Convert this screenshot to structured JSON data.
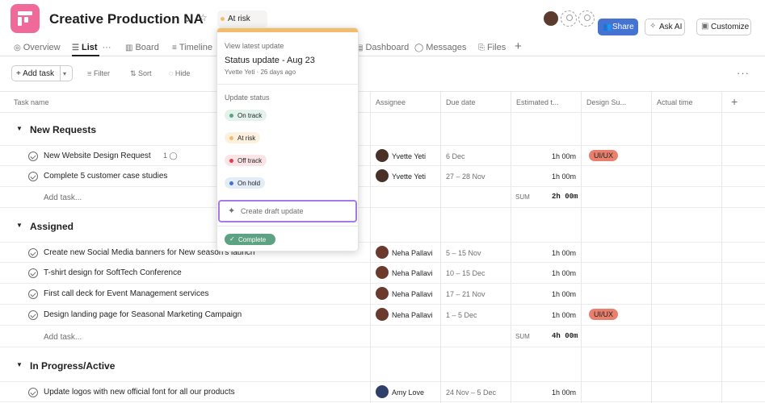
{
  "project": {
    "title": "Creative Production NA",
    "status": "At risk",
    "colors": {
      "brand": "#f06a99",
      "at_risk": "#f1bd6c",
      "share": "#4573d2",
      "badge": "#e8806d"
    }
  },
  "header_buttons": {
    "share": "Share",
    "ask_ai": "Ask AI",
    "customize": "Customize"
  },
  "tabs": [
    {
      "label": "Overview",
      "icon": "overview-icon"
    },
    {
      "label": "List",
      "icon": "list-icon",
      "active": true
    },
    {
      "label": "Board",
      "icon": "board-icon"
    },
    {
      "label": "Timeline",
      "icon": "timeline-icon"
    },
    {
      "label": "Dashboard",
      "icon": "dashboard-icon"
    },
    {
      "label": "Messages",
      "icon": "messages-icon"
    },
    {
      "label": "Files",
      "icon": "files-icon"
    }
  ],
  "toolbar": {
    "add_task": "+ Add task",
    "filter": "Filter",
    "sort": "Sort",
    "hide": "Hide"
  },
  "columns": [
    "Task name",
    "Assignee",
    "Due date",
    "Estimated t...",
    "Design Su...",
    "Actual time"
  ],
  "sections": [
    {
      "name": "New Requests",
      "tasks": [
        {
          "name": "New Website Design Request",
          "subtasks": "1",
          "assignee": "Yvette Yeti",
          "due": "6 Dec",
          "est": "1h 00m",
          "design": "UI/UX"
        },
        {
          "name": "Complete 5 customer case studies",
          "assignee": "Yvette Yeti",
          "due": "27 – 28 Nov",
          "est": "1h 00m"
        }
      ],
      "add_task": "Add task...",
      "sum_label": "SUM",
      "sum_value": "2h 00m"
    },
    {
      "name": "Assigned",
      "tasks": [
        {
          "name": "Create new Social Media banners for New season's launch",
          "assignee": "Neha Pallavi",
          "due": "5 – 15 Nov",
          "est": "1h 00m"
        },
        {
          "name": "T-shirt design for SoftTech Conference",
          "assignee": "Neha Pallavi",
          "due": "10 – 15 Dec",
          "est": "1h 00m"
        },
        {
          "name": "First call deck for Event Management services",
          "assignee": "Neha Pallavi",
          "due": "17 – 21 Nov",
          "est": "1h 00m"
        },
        {
          "name": "Design landing page for Seasonal Marketing Campaign",
          "assignee": "Neha Pallavi",
          "due": "1 – 5 Dec",
          "est": "1h 00m",
          "design": "UI/UX"
        }
      ],
      "add_task": "Add task...",
      "sum_label": "SUM",
      "sum_value": "4h 00m"
    },
    {
      "name": "In Progress/Active",
      "tasks": [
        {
          "name": "Update logos with new official font for all our products",
          "assignee": "Amy Love",
          "due": "24 Nov – 5 Dec",
          "est": "1h 00m"
        }
      ]
    }
  ],
  "popup": {
    "view_latest": "View latest update",
    "update_title": "Status update - Aug 23",
    "update_meta": "Yvette Yeti · 26 days ago",
    "update_status_label": "Update status",
    "options": [
      {
        "label": "On track",
        "bg": "#e3f3ec",
        "dot": "#5da283"
      },
      {
        "label": "At risk",
        "bg": "#fcf1de",
        "dot": "#f1bd6c"
      },
      {
        "label": "Off track",
        "bg": "#fbe4e6",
        "dot": "#e8384f"
      },
      {
        "label": "On hold",
        "bg": "#e4ecf8",
        "dot": "#4573d2"
      }
    ],
    "create_draft": "Create draft update",
    "complete": "Complete"
  }
}
